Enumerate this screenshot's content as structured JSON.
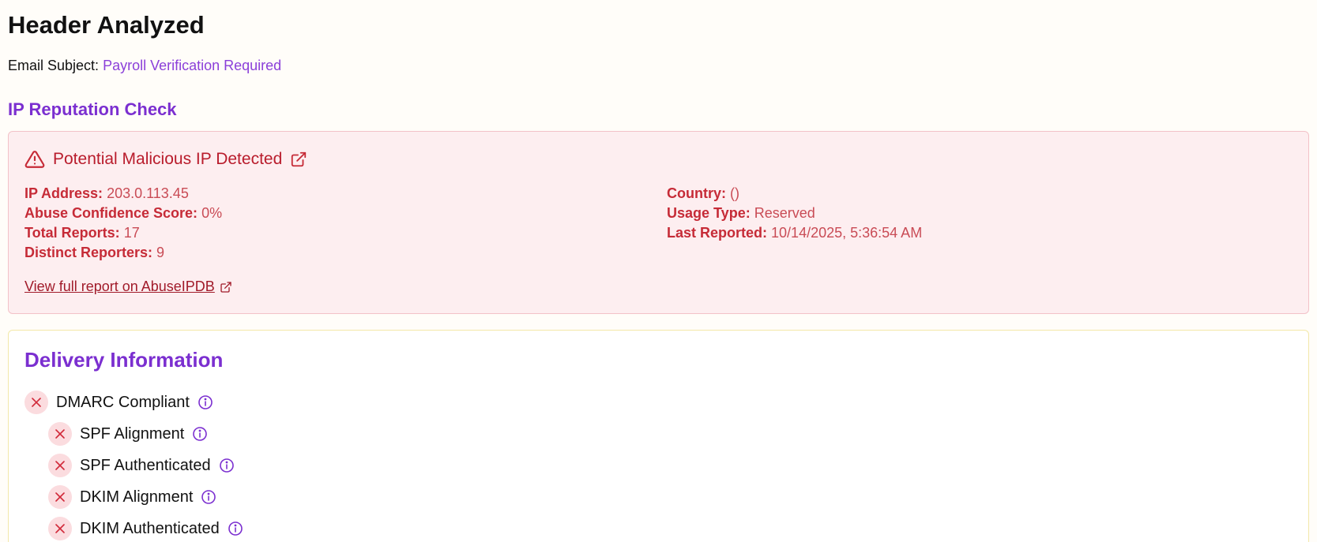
{
  "header": {
    "title": "Header Analyzed",
    "subject_label": "Email Subject:",
    "subject_value": "Payroll Verification Required"
  },
  "ip_reputation": {
    "section_title": "IP Reputation Check",
    "alert_title": "Potential Malicious IP Detected",
    "left_fields": [
      {
        "label": "IP Address:",
        "value": "203.0.113.45"
      },
      {
        "label": "Abuse Confidence Score:",
        "value": "0%"
      },
      {
        "label": "Total Reports:",
        "value": "17"
      },
      {
        "label": "Distinct Reporters:",
        "value": "9"
      }
    ],
    "right_fields": [
      {
        "label": "Country:",
        "value": "()"
      },
      {
        "label": "Usage Type:",
        "value": "Reserved"
      },
      {
        "label": "Last Reported:",
        "value": "10/14/2025, 5:36:54 AM"
      }
    ],
    "report_link": "View full report on AbuseIPDB"
  },
  "delivery": {
    "title": "Delivery Information",
    "checks": [
      {
        "label": "DMARC Compliant",
        "status": "fail"
      },
      {
        "label": "SPF Alignment",
        "status": "fail"
      },
      {
        "label": "SPF Authenticated",
        "status": "fail"
      },
      {
        "label": "DKIM Alignment",
        "status": "fail"
      },
      {
        "label": "DKIM Authenticated",
        "status": "fail"
      }
    ]
  },
  "colors": {
    "accent": "#7b2fd0",
    "danger": "#c62b37",
    "danger_bg": "#fdeef0"
  },
  "icons": {
    "alert": "warning-triangle-icon",
    "external": "external-link-icon",
    "fail": "x-icon",
    "info": "info-icon"
  }
}
